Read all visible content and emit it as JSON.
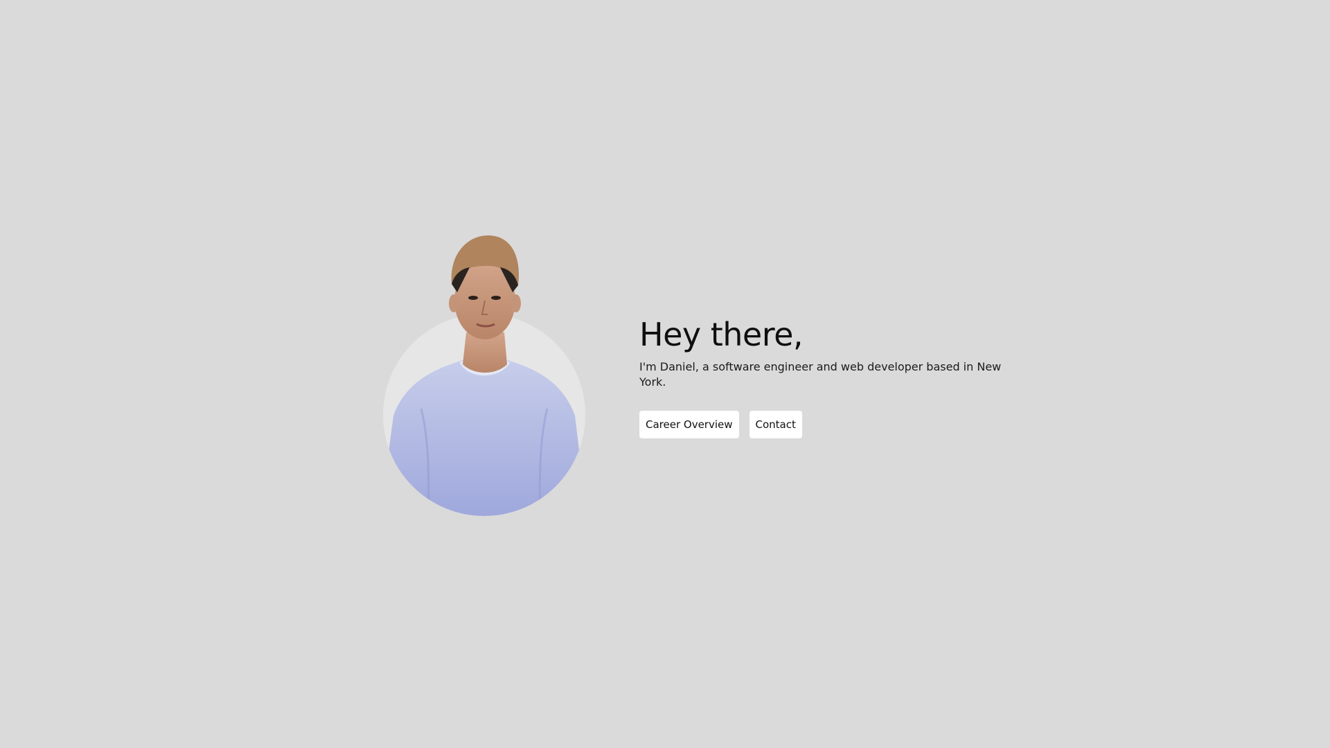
{
  "hero": {
    "heading": "Hey there,",
    "intro": "I'm Daniel, a software engineer and web developer based in New York."
  },
  "actions": {
    "career_label": "Career Overview",
    "contact_label": "Contact"
  },
  "colors": {
    "background": "#dadada",
    "disc": "#e6e6e6",
    "button_bg": "#ffffff",
    "text": "#0f0f0f"
  }
}
